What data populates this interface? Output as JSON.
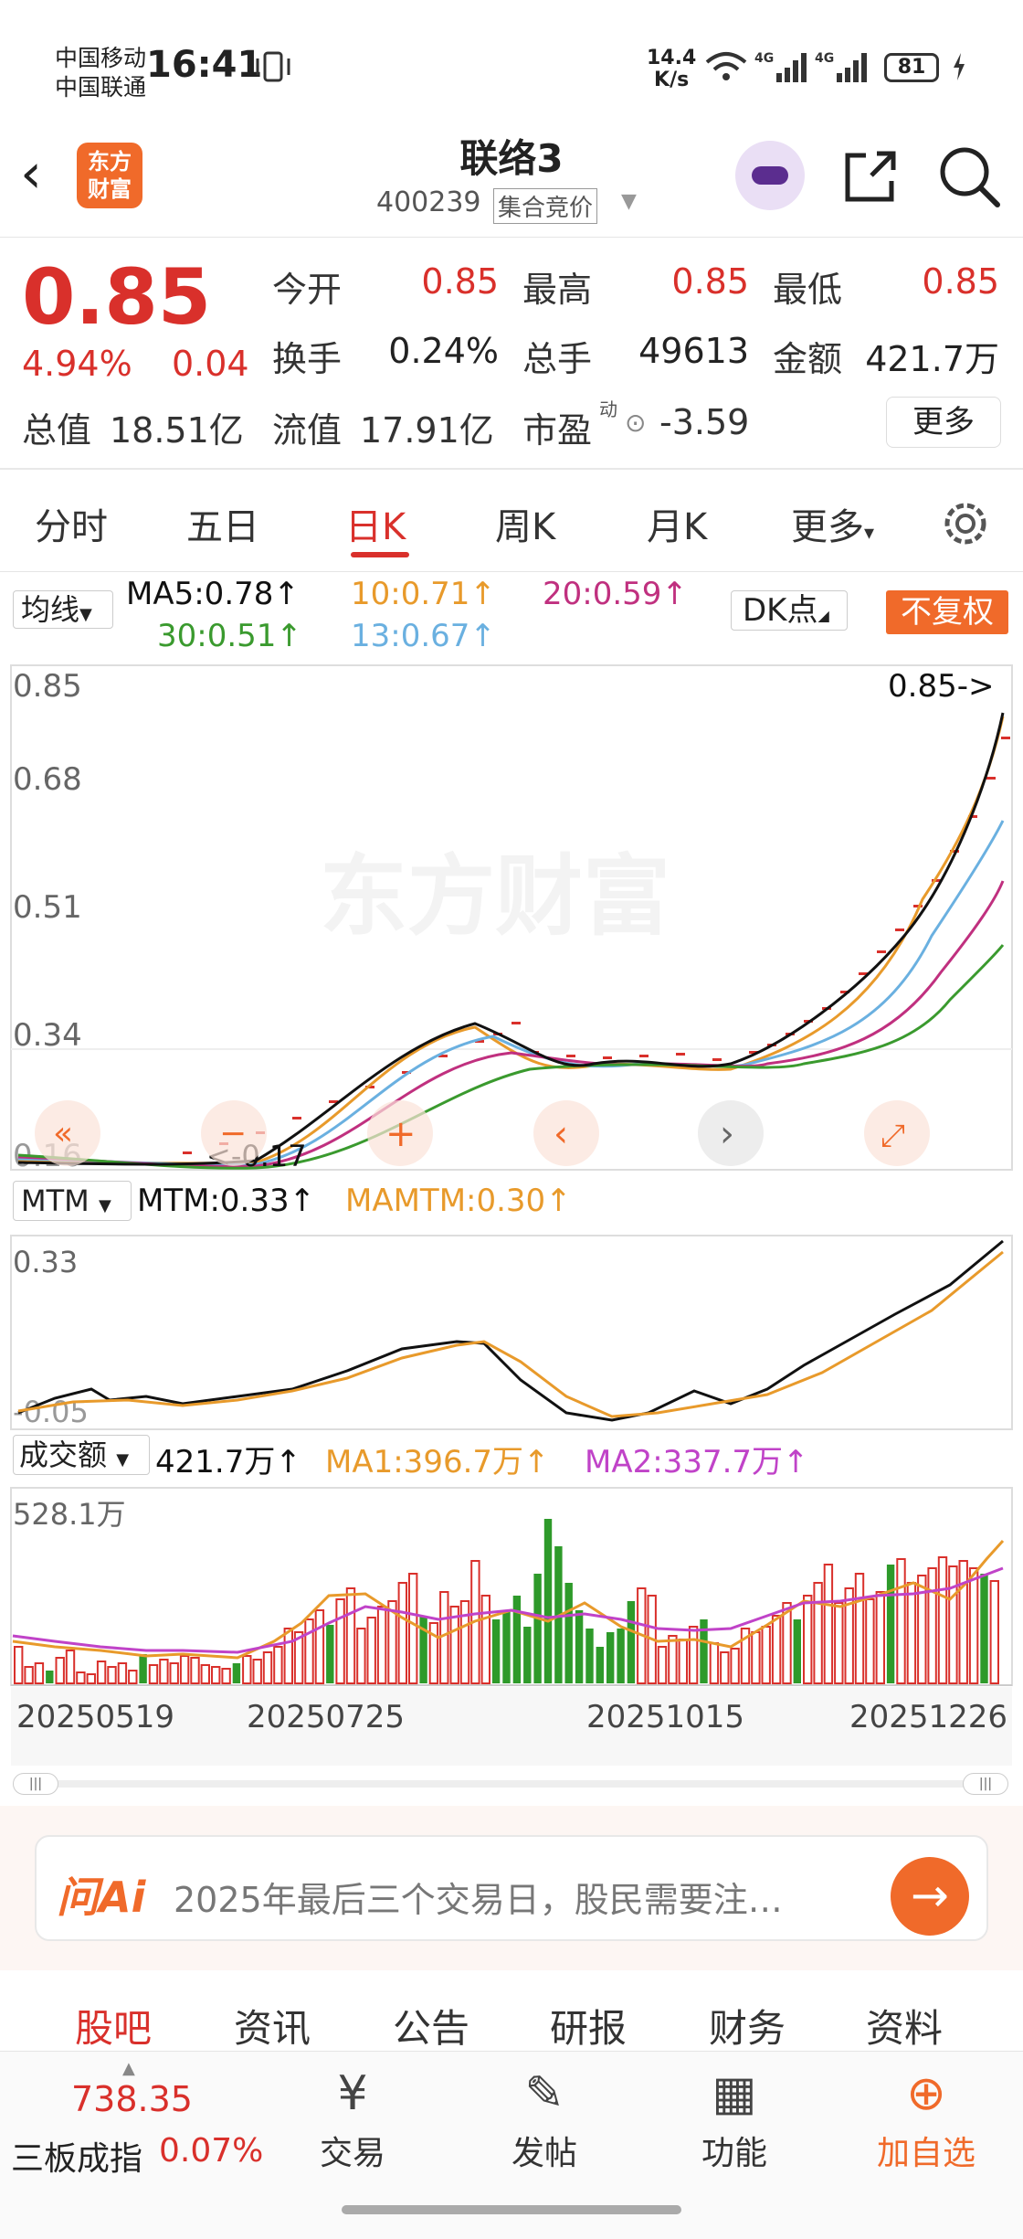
{
  "status_bar": {
    "carrier1": "中国移动",
    "carrier2": "中国联通",
    "time": "16:41",
    "net_speed_top": "14.4",
    "net_speed_bottom": "K/s",
    "battery": "81"
  },
  "header": {
    "stock_name": "联络3",
    "stock_code": "400239",
    "auction_label": "集合竞价",
    "logo_line1": "东方",
    "logo_line2": "财富"
  },
  "quote": {
    "price": "0.85",
    "change_pct": "4.94%",
    "change": "0.04",
    "open_label": "今开",
    "open": "0.85",
    "high_label": "最高",
    "high": "0.85",
    "low_label": "最低",
    "low": "0.85",
    "turnover_label": "换手",
    "turnover": "0.24%",
    "volume_label": "总手",
    "volume": "49613",
    "amount_label": "金额",
    "amount": "421.7万",
    "mcap_label": "总值",
    "mcap": "18.51亿",
    "float_label": "流值",
    "float": "17.91亿",
    "pe_label": "市盈",
    "pe_sup": "动",
    "pe": "-3.59",
    "more": "更多"
  },
  "tabs": [
    "分时",
    "五日",
    "日K",
    "周K",
    "月K",
    "更多"
  ],
  "ma_legend": {
    "select": "均线",
    "ma5": "MA5:0.78↑",
    "ma10": "10:0.71↑",
    "ma20": "20:0.59↑",
    "ma30": "30:0.51↑",
    "ma13": "13:0.67↑",
    "dk": "DK点",
    "adjust": "不复权"
  },
  "colors": {
    "up": "#d9302b",
    "down": "#2e9a2a",
    "ma5": "#111111",
    "ma10": "#e89a2b",
    "ma13": "#6ab0e0",
    "ma20": "#c0307f",
    "ma30": "#3a9a2e",
    "accent": "#f06a2a"
  },
  "main_chart": {
    "y_labels": [
      "0.85",
      "0.68",
      "0.51",
      "0.34",
      "0.16"
    ],
    "latest_label": "0.85->",
    "low_label": "<-0.17",
    "watermark": "东方财富"
  },
  "mtm": {
    "select": "MTM",
    "mtm": "MTM:0.33↑",
    "mamtm": "MAMTM:0.30↑",
    "y_top": "0.33",
    "y_bottom": "-0.05"
  },
  "volume": {
    "select": "成交额",
    "value": "421.7万↑",
    "ma1": "MA1:396.7万↑",
    "ma2": "MA2:337.7万↑",
    "y_top": "528.1万"
  },
  "x_dates": [
    "20250519",
    "20250725",
    "20251015",
    "20251226"
  ],
  "ask_ai": {
    "label": "问Ai",
    "text": "2025年最后三个交易日，股民需要注…"
  },
  "subnav": [
    "股吧",
    "资讯",
    "公告",
    "研报",
    "财务",
    "资料"
  ],
  "bottom": {
    "index_value": "738.35",
    "index_name": "三板成指",
    "index_pct": "0.07%",
    "nav": [
      {
        "icon": "¥",
        "label": "交易"
      },
      {
        "icon": "✎",
        "label": "发帖"
      },
      {
        "icon": "▦",
        "label": "功能"
      },
      {
        "icon": "⊕",
        "label": "加自选"
      }
    ]
  }
}
